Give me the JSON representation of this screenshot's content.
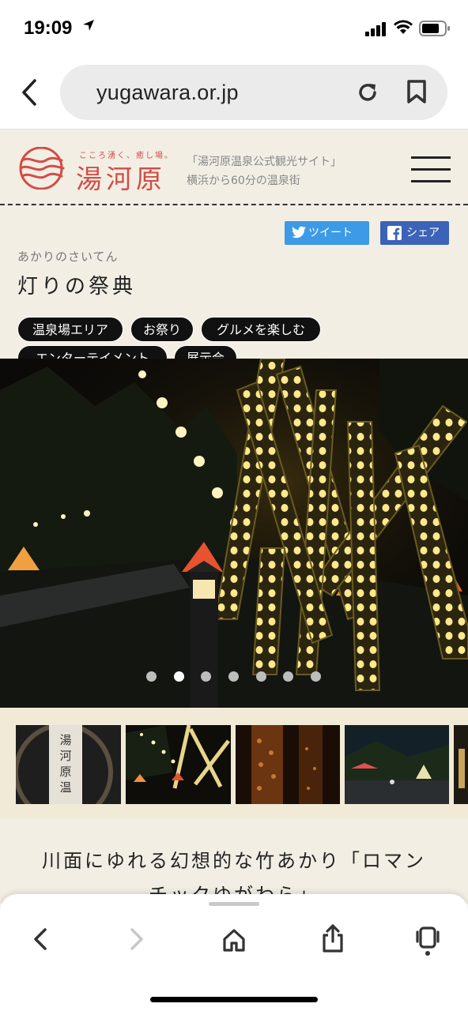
{
  "status_bar": {
    "time": "19:09",
    "icons": [
      "location-arrow-icon",
      "signal-icon",
      "wifi-icon",
      "battery-icon"
    ]
  },
  "browser": {
    "url": "yugawara.or.jp",
    "icons": [
      "back-icon",
      "reload-icon",
      "bookmark-icon"
    ]
  },
  "site_header": {
    "logo_tagline": "こころ湧く、癒し場。",
    "logo_text": "湯河原",
    "description_line1": "「湯河原温泉公式観光サイト」",
    "description_line2": "横浜から60分の温泉街"
  },
  "share_buttons": {
    "tweet_label": "ツイート",
    "share_label": "シェア"
  },
  "article": {
    "subtitle": "あかりのさいてん",
    "title": "灯りの祭典",
    "tags": [
      "温泉場エリア",
      "お祭り",
      "グルメを楽しむ",
      "エンターテイメント",
      "展示会"
    ],
    "body_heading_line1": "川面にゆれる幻想的な竹あかり「ロマン",
    "body_heading_line2": "チックゆがわら」"
  },
  "slideshow": {
    "slide_count": 7,
    "active_index": 1,
    "thumbnail_count": 5
  },
  "toolbar": {
    "icons": [
      "back-icon",
      "forward-icon",
      "home-icon",
      "share-icon",
      "tabs-icon"
    ]
  },
  "colors": {
    "brand_red": "#d44b46",
    "page_bg": "#f2eee4",
    "twitter_blue": "#3d9ae6",
    "facebook_blue": "#3b63b7",
    "tag_bg": "#111111"
  }
}
